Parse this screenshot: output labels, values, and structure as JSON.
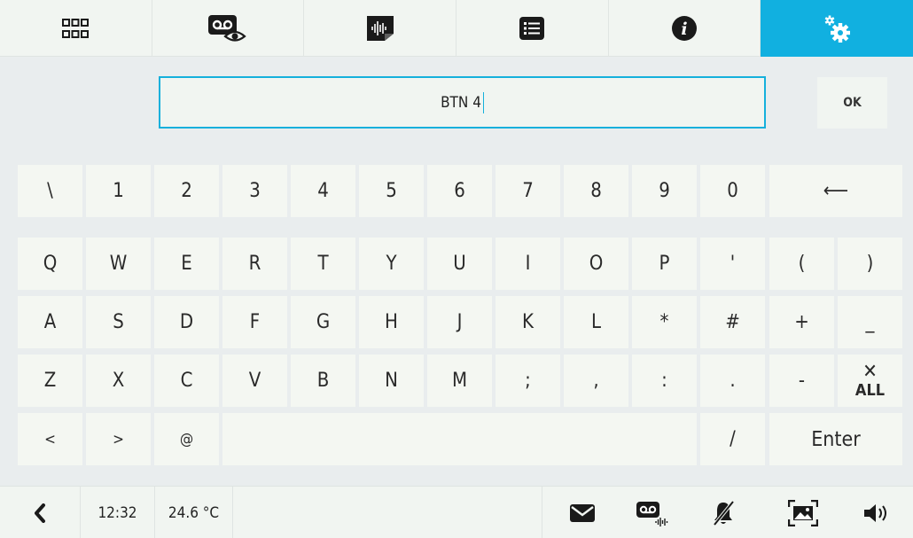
{
  "tabs": [
    {
      "id": "apps",
      "icon": "grid-icon"
    },
    {
      "id": "video-memory",
      "icon": "voicemail-eye-icon"
    },
    {
      "id": "audio-memo",
      "icon": "audio-note-icon"
    },
    {
      "id": "list",
      "icon": "list-icon"
    },
    {
      "id": "info",
      "icon": "info-icon"
    },
    {
      "id": "settings",
      "icon": "settings-gears-icon",
      "active": true
    }
  ],
  "entry": {
    "value": "BTN 4"
  },
  "ok_label": "OK",
  "keyboard": {
    "row1": [
      "\\",
      "1",
      "2",
      "3",
      "4",
      "5",
      "6",
      "7",
      "8",
      "9",
      "0"
    ],
    "backspace": "⟵",
    "row2": [
      "Q",
      "W",
      "E",
      "R",
      "T",
      "Y",
      "U",
      "I",
      "O",
      "P",
      "'",
      "(",
      ")"
    ],
    "row3": [
      "A",
      "S",
      "D",
      "F",
      "G",
      "H",
      "J",
      "K",
      "L",
      "*",
      "#",
      "+",
      "_"
    ],
    "row4": [
      "Z",
      "X",
      "C",
      "V",
      "B",
      "N",
      "M",
      ";",
      ",",
      ":",
      ".",
      "-"
    ],
    "clear_all": {
      "symbol": "✕",
      "label": "ALL"
    },
    "row5": [
      "<",
      ">",
      "@"
    ],
    "slash": "/",
    "enter": "Enter"
  },
  "status": {
    "time": "12:32",
    "temperature": "24.6 °C"
  },
  "bottom_icons": [
    "back-icon",
    "mail-icon",
    "voicemail-audio-icon",
    "mute-bell-icon",
    "picture-frame-icon",
    "speaker-icon"
  ],
  "colors": {
    "accent": "#11b0e0",
    "key_bg": "#f4f7f2",
    "page_bg": "#e9edee"
  }
}
